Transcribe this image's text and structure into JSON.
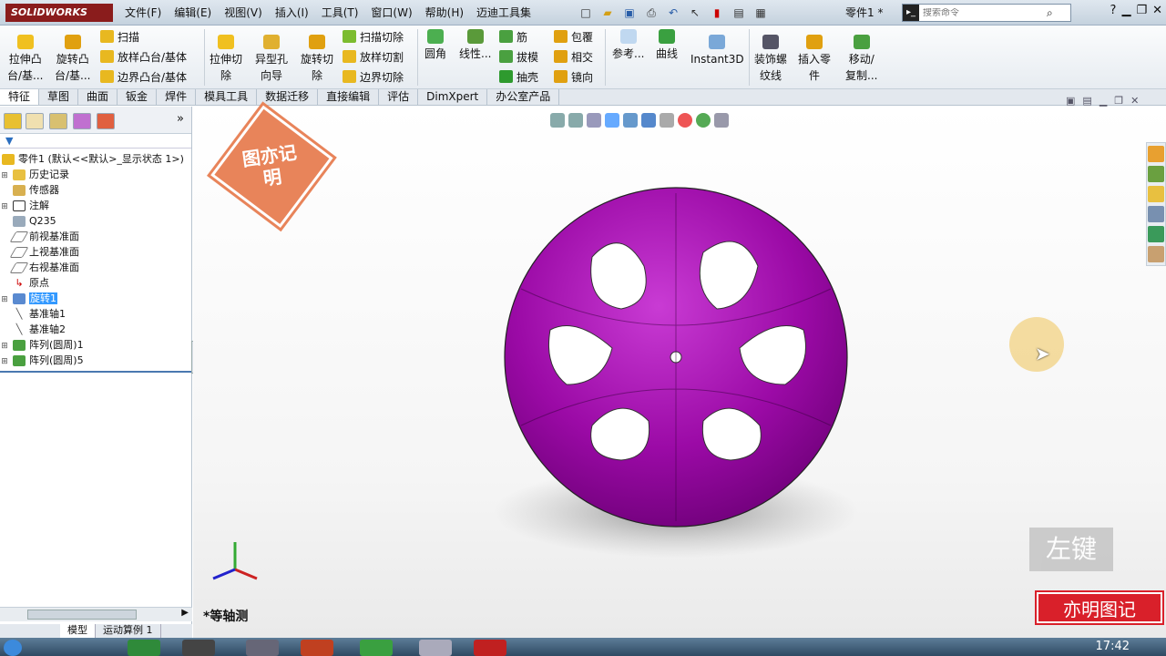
{
  "app": {
    "name": "SOLIDWORKS",
    "doc_title": "零件1 *"
  },
  "menu": [
    "文件(F)",
    "编辑(E)",
    "视图(V)",
    "插入(I)",
    "工具(T)",
    "窗口(W)",
    "帮助(H)",
    "迈迪工具集"
  ],
  "search": {
    "placeholder": "搜索命令"
  },
  "ribbon": {
    "extrude_boss": "拉伸凸\n台/基...",
    "revolve_boss": "旋转凸\n台/基...",
    "sweep": "扫描",
    "loft": "放样凸台/基体",
    "boundary": "边界凸台/基体",
    "extrude_cut": "拉伸切\n除",
    "hole": "异型孔\n向导",
    "revolve_cut": "旋转切\n除",
    "sweep_cut": "扫描切除",
    "loft_cut": "放样切割",
    "boundary_cut": "边界切除",
    "fillet": "圆角",
    "linear_pattern": "线性...",
    "rib": "筋",
    "draft": "拔模",
    "shell": "抽壳",
    "wrap": "包覆",
    "intersect": "相交",
    "mirror": "镜向",
    "reference": "参考...",
    "curves": "曲线",
    "instant3d": "Instant3D",
    "cosmetic_thread": "装饰螺\n纹线",
    "insert_part": "插入零\n件",
    "move_copy": "移动/\n复制..."
  },
  "tabs": [
    "特征",
    "草图",
    "曲面",
    "钣金",
    "焊件",
    "模具工具",
    "数据迁移",
    "直接编辑",
    "评估",
    "DimXpert",
    "办公室产品"
  ],
  "tree": {
    "root": "零件1 (默认<<默认>_显示状态 1>)",
    "items": [
      "历史记录",
      "传感器",
      "注解",
      "Q235",
      "前视基准面",
      "上视基准面",
      "右视基准面",
      "原点",
      "旋转1",
      "基准轴1",
      "基准轴2",
      "阵列(圆周)1",
      "阵列(圆周)5"
    ]
  },
  "bottom_tabs": [
    "模型",
    "运动算例 1"
  ],
  "view_label": "*等轴测",
  "overlay": {
    "left_key": "左键",
    "watermark": "亦明图记",
    "stamp": "图亦记明"
  },
  "taskbar": {
    "clock": "17:42"
  },
  "colors": {
    "part": "#9b0aa6",
    "ribbon_bg": "#eef2f6"
  }
}
